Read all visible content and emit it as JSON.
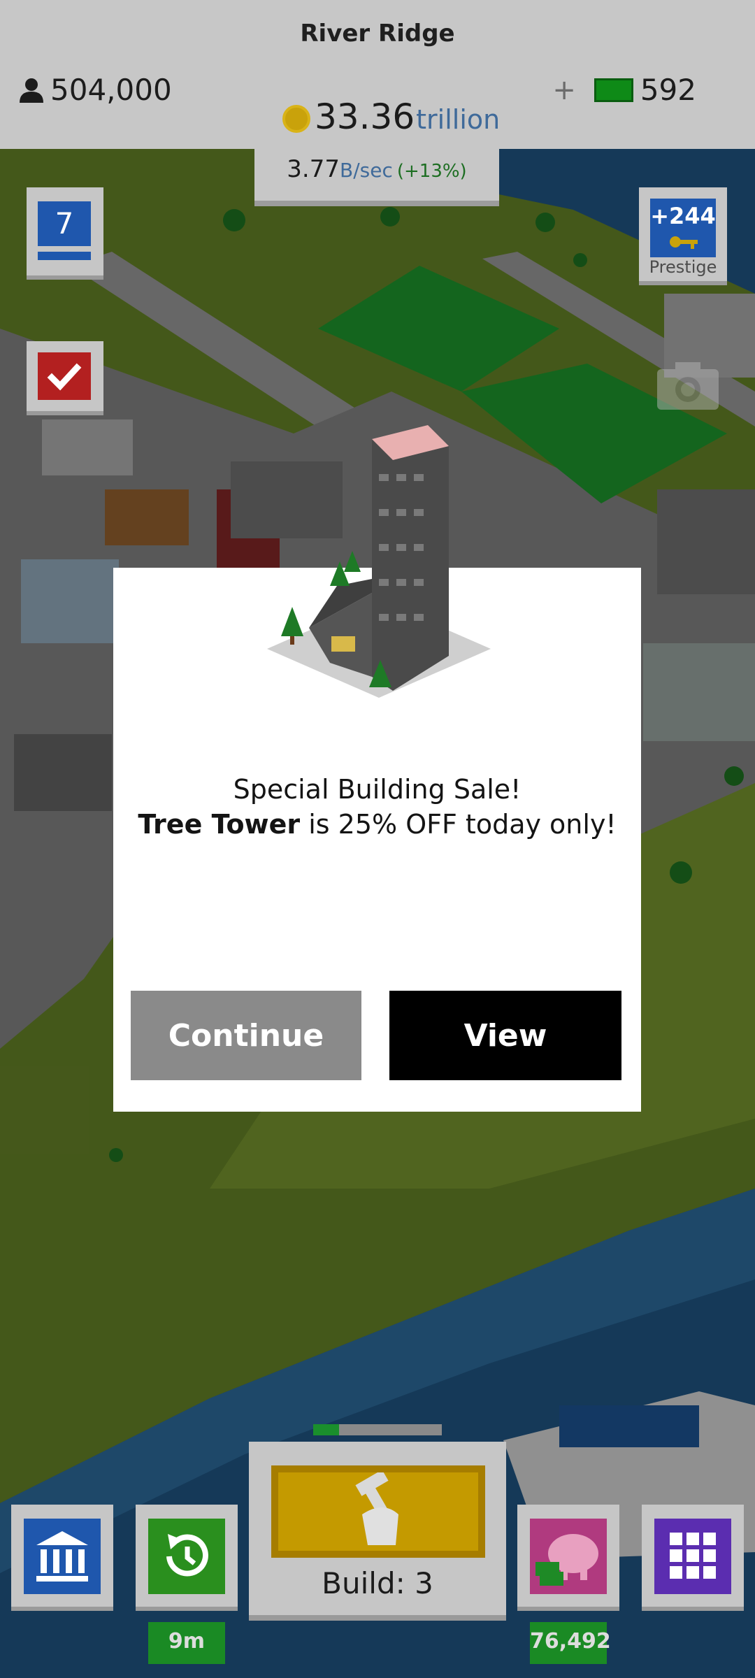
{
  "hud": {
    "city_name": "River Ridge",
    "population": "504,000",
    "plus": "+",
    "bucks": "592",
    "money": "33.36",
    "money_unit": "trillion",
    "rate": "3.77",
    "rate_unit": "B/sec",
    "rate_bonus": "(+13%)"
  },
  "side": {
    "level": "7",
    "prestige_amount": "+244",
    "prestige_label": "Prestige"
  },
  "modal": {
    "line1": "Special Building Sale!",
    "building": "Tree Tower",
    "line2_rest": " is 25% OFF today only!",
    "continue_label": "Continue",
    "view_label": "View"
  },
  "toolbar": {
    "build_label": "Build: 3",
    "build_progress": 0.2,
    "time_value": "9m",
    "piggy_value": "76,492"
  },
  "icons": [
    "person-icon",
    "bucks-icon",
    "coin-icon",
    "level-icon",
    "checkmark-icon",
    "key-icon",
    "camera-icon",
    "bank-icon",
    "clock-icon",
    "hammer-hand-icon",
    "piggy-bank-icon",
    "grid-icon"
  ],
  "colors": {
    "accent_blue": "#1f57ad",
    "accent_green": "#2a8f1e",
    "build_yellow": "#c49a00",
    "modal_bg": "#ffffff"
  }
}
